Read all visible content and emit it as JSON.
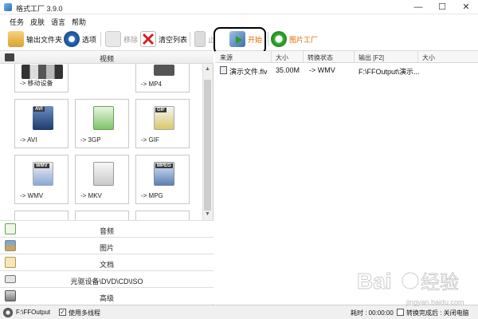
{
  "window": {
    "title": "格式工厂 3.9.0"
  },
  "menu": [
    "任务",
    "皮肤",
    "语言",
    "帮助"
  ],
  "toolbar": {
    "output_folder": "输出文件夹",
    "options": "选项",
    "remove": "移除",
    "clear_list": "清空列表",
    "stop": "止",
    "start": "开始",
    "picture_factory": "图片工厂"
  },
  "categories": {
    "video": "视频",
    "audio": "音频",
    "picture": "图片",
    "document": "文档",
    "optical": "光驱设备\\DVD\\CD\\ISO",
    "advanced": "高级"
  },
  "formats": [
    {
      "label": "-> 移动设备",
      "icon": "mobile-device-icon"
    },
    {
      "label": "-> MP4",
      "icon": "mp4-icon"
    },
    {
      "label": "-> AVI",
      "icon": "avi-icon",
      "badge": "AVI"
    },
    {
      "label": "-> 3GP",
      "icon": "3gp-icon"
    },
    {
      "label": "-> GIF",
      "icon": "gif-icon",
      "badge": "GIF"
    },
    {
      "label": "-> WMV",
      "icon": "wmv-icon",
      "badge": "WMV"
    },
    {
      "label": "-> MKV",
      "icon": "mkv-icon"
    },
    {
      "label": "-> MPG",
      "icon": "mpg-icon",
      "badge": "MPEG"
    }
  ],
  "table": {
    "columns": [
      "来源",
      "大小",
      "转换状态",
      "输出 [F2]",
      "大小"
    ],
    "rows": [
      {
        "source": "演示文件.flv",
        "size": "35.00M",
        "status": "-> WMV",
        "output": "F:\\FFOutput\\演示...",
        "out_size": ""
      }
    ]
  },
  "status": {
    "output_path": "F:\\FFOutput",
    "multithread": "使用多线程",
    "elapsed": "耗时 : 00:00:00",
    "after_convert": "转换完成后 : 关闭电脑"
  },
  "watermark": {
    "brand": "Baidu",
    "text": "经验",
    "url": "jingyan.baidu.com"
  },
  "colors": {
    "start_orange": "#e36a00",
    "highlight": "#000000"
  }
}
